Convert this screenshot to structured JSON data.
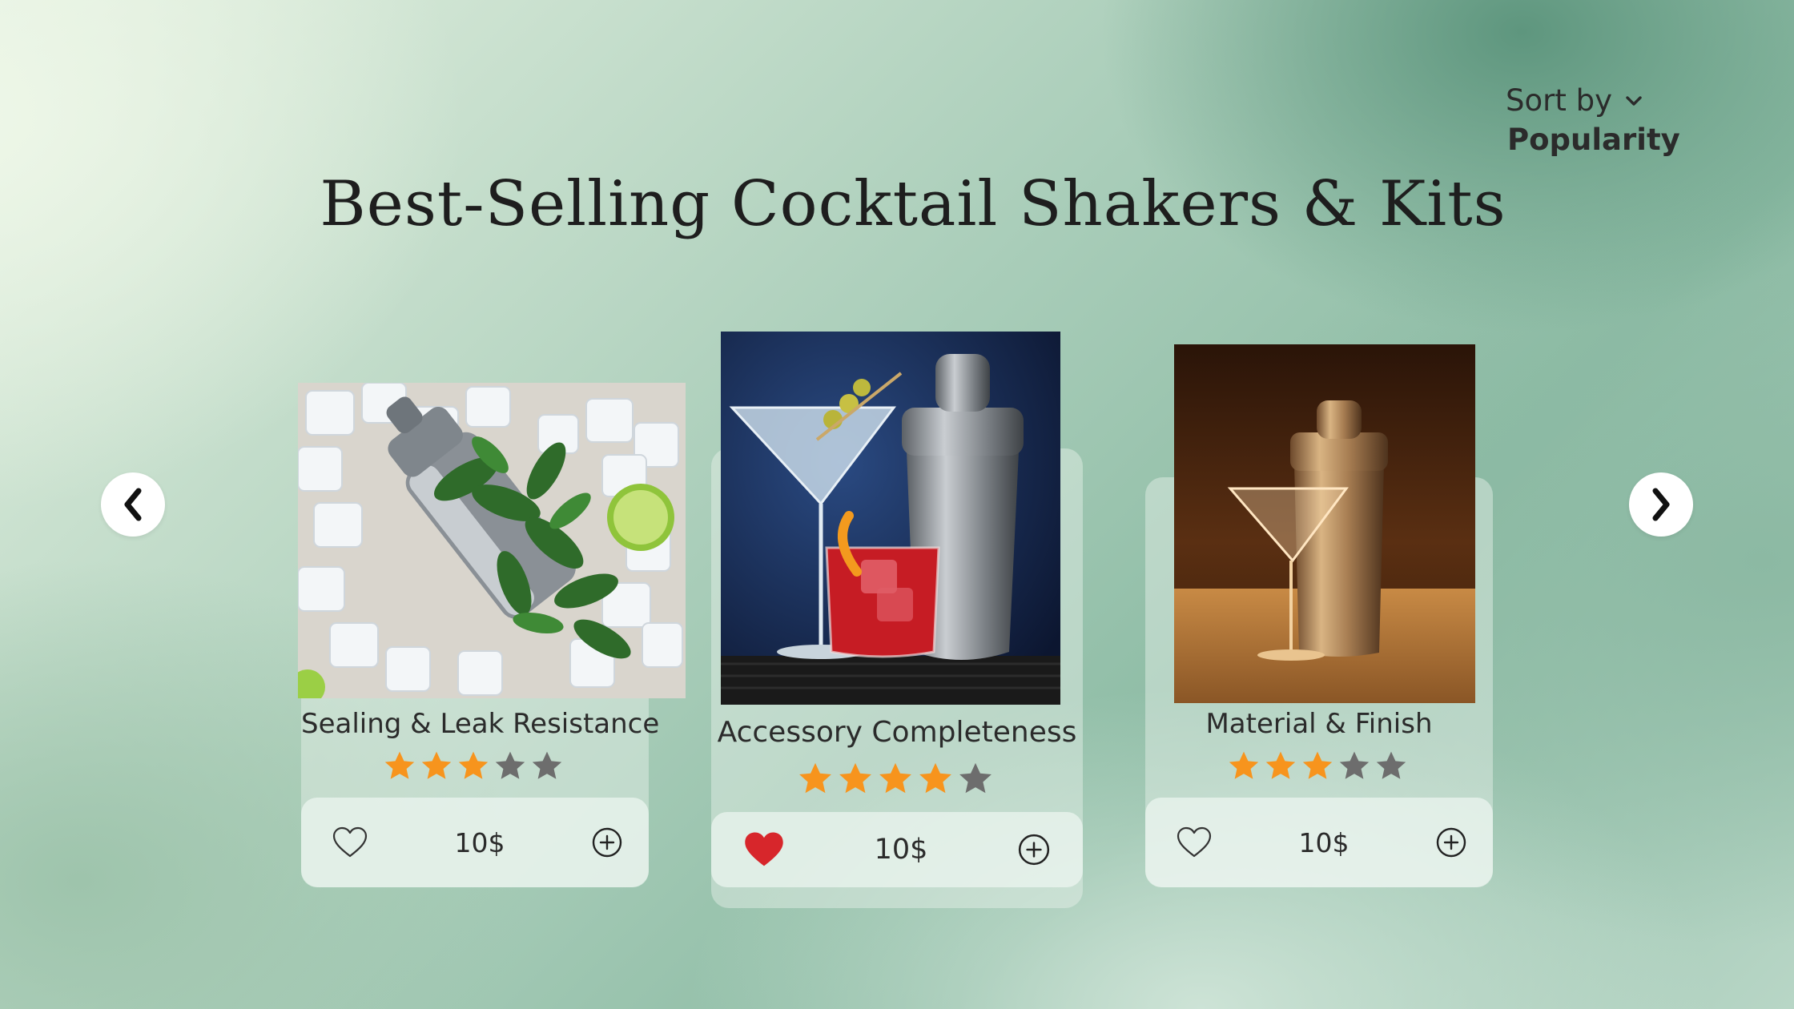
{
  "sort": {
    "label": "Sort by",
    "value": "Popularity"
  },
  "title": "Best-Selling Cocktail Shakers & Kits",
  "colors": {
    "star_on": "#f7941d",
    "star_off": "#6d6d6d",
    "heart_filled": "#d7262b"
  },
  "products": [
    {
      "name": "Sealing & Leak Resistance",
      "rating": 3,
      "max_rating": 5,
      "price": "10$",
      "liked": false,
      "image": "shaker-on-ice-with-mint-and-lime"
    },
    {
      "name": "Accessory Completeness",
      "rating": 4,
      "max_rating": 5,
      "price": "10$",
      "liked": true,
      "image": "martini-and-negroni-with-shaker"
    },
    {
      "name": "Material & Finish",
      "rating": 3,
      "max_rating": 5,
      "price": "10$",
      "liked": false,
      "image": "copper-shaker-and-glass"
    }
  ]
}
